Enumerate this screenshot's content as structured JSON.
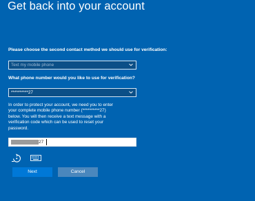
{
  "page": {
    "title": "Get back into your account"
  },
  "contact_method": {
    "question": "Please choose the second contact method we should use for verification:",
    "selected": "Text my mobile phone"
  },
  "phone_number": {
    "question": "What phone number would you like to use for verification?",
    "selected": "**********27"
  },
  "instructions": {
    "lines": [
      "In order to protect your account, we need you to enter",
      "your complete mobile phone number (**********27)",
      "below. You will then receive a text message with a",
      "verification code which can be used to reset your",
      "password."
    ]
  },
  "phone_input": {
    "value": "27"
  },
  "icons": {
    "ease_of_access": "ease-of-access-icon",
    "keyboard": "keyboard-icon"
  },
  "buttons": {
    "next": "Next",
    "cancel": "Cancel"
  },
  "colors": {
    "background": "#0063b1",
    "primary_button": "#0078d7",
    "secondary_button": "#4a87bd"
  }
}
